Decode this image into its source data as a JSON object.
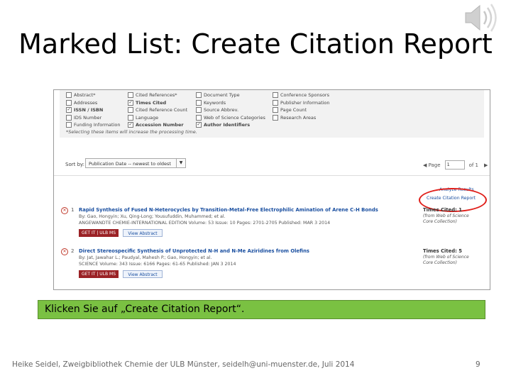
{
  "slide": {
    "title": "Marked List: Create Citation Report",
    "instruction": "Klicken Sie auf „Create Citation Report“.",
    "footer": "Heike Seidel, Zweigbibliothek Chemie der ULB Münster, seidelh@uni-muenster.de, Juli 2014",
    "page_number": "9",
    "audio_icon": "speaker-icon"
  },
  "fields": {
    "columns": [
      [
        {
          "label": "Abstract*",
          "checked": false
        },
        {
          "label": "Addresses",
          "checked": false
        },
        {
          "label": "ISSN / ISBN",
          "checked": true
        },
        {
          "label": "IDS Number",
          "checked": false
        },
        {
          "label": "Funding Information",
          "checked": false
        }
      ],
      [
        {
          "label": "Cited References*",
          "checked": false
        },
        {
          "label": "Times Cited",
          "checked": true
        },
        {
          "label": "Cited Reference Count",
          "checked": false
        },
        {
          "label": "Language",
          "checked": false
        },
        {
          "label": "Accession Number",
          "checked": true
        }
      ],
      [
        {
          "label": "Document Type",
          "checked": false
        },
        {
          "label": "Keywords",
          "checked": false
        },
        {
          "label": "Source Abbrev.",
          "checked": false
        },
        {
          "label": "Web of Science Categories",
          "checked": false
        },
        {
          "label": "Author Identifiers",
          "checked": true
        }
      ],
      [
        {
          "label": "Conference Sponsors",
          "checked": false
        },
        {
          "label": "Publisher Information",
          "checked": false
        },
        {
          "label": "Page Count",
          "checked": false
        },
        {
          "label": "Research Areas",
          "checked": false
        }
      ]
    ],
    "note": "*Selecting these items will increase the processing time."
  },
  "sort": {
    "label": "Sort by:",
    "selected": "Publication Date -- newest to oldest",
    "prev": "◀ Page",
    "page_value": "1",
    "of": "of 1",
    "next": "▶"
  },
  "sidebar": {
    "analyze": "Analyze Results",
    "create_report": "Create Citation Report"
  },
  "records": [
    {
      "num": "1",
      "title": "Rapid Synthesis of Fused N-Heterocycles by Transition-Metal-Free Electrophilic Amination of Arene C-H Bonds",
      "authors": "By: Gao, Hongyin; Xu, Qing-Long; Yousufuddin, Muhammed; et al.",
      "source": "ANGEWANDTE CHEMIE-INTERNATIONAL EDITION  Volume: 53   Issue: 10   Pages: 2701-2705   Published: MAR 3 2014",
      "times_cited": "Times Cited: 1",
      "tc_note": "(from Web of Science Core Collection)",
      "getit": "GET IT | ULB MS",
      "view": "View Abstract"
    },
    {
      "num": "2",
      "title": "Direct Stereospecific Synthesis of Unprotected N-H and N-Me Aziridines from Olefins",
      "authors": "By: Jat, Jawahar L.; Paudyal, Mahesh P.; Gao, Hongyin; et al.",
      "source": "SCIENCE  Volume: 343   Issue: 6166   Pages: 61-65   Published: JAN 3 2014",
      "times_cited": "Times Cited: 5",
      "tc_note": "(from Web of Science Core Collection)",
      "getit": "GET IT | ULB MS",
      "view": "View Abstract"
    }
  ],
  "colors": {
    "callout_bg": "#7ac142",
    "highlight_ring": "#e0201b",
    "link_blue": "#1a4fa0"
  }
}
